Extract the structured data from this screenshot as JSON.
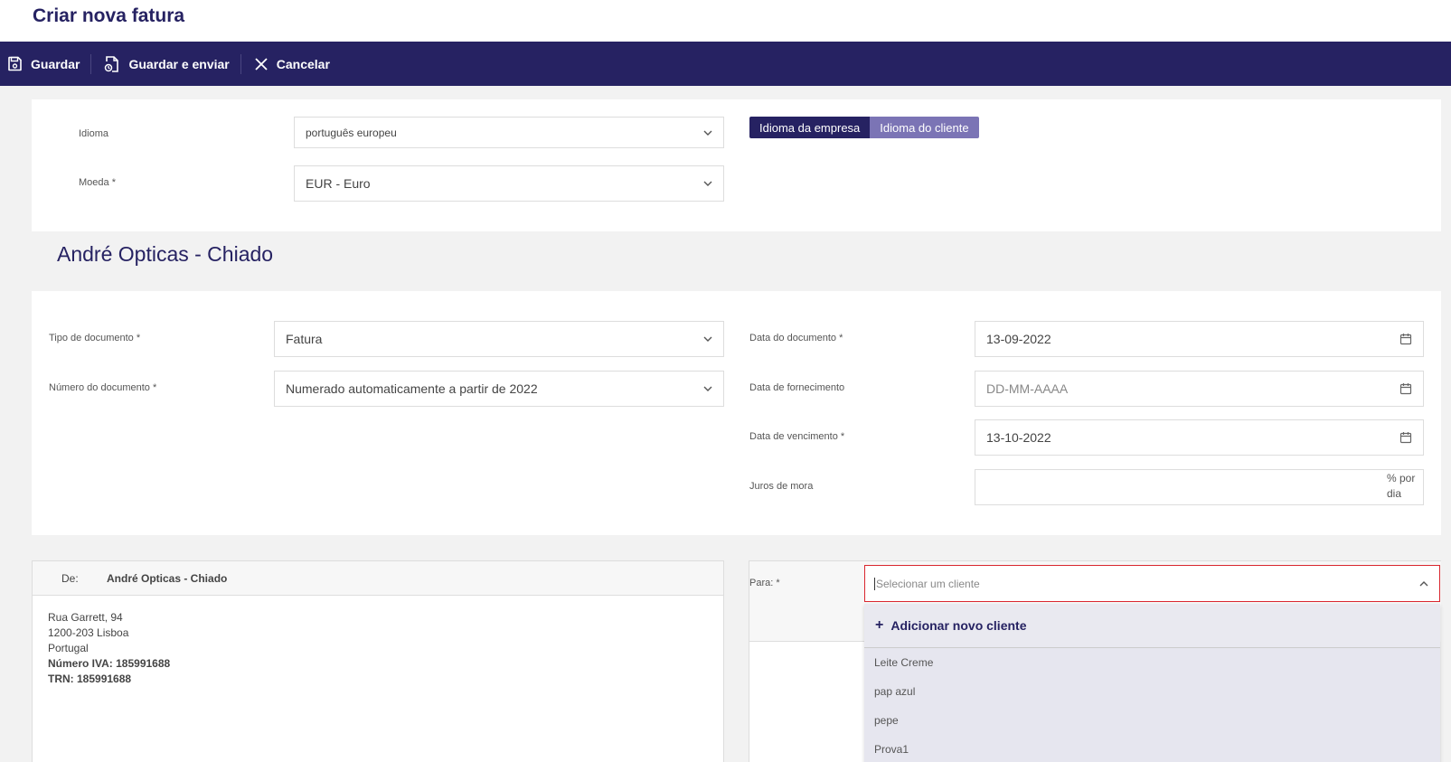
{
  "page": {
    "title": "Criar nova fatura"
  },
  "toolbar": {
    "save_label": "Guardar",
    "save_send_label": "Guardar e enviar",
    "cancel_label": "Cancelar"
  },
  "settings": {
    "language_label": "Idioma",
    "language_value": "português europeu",
    "currency_label": "Moeda *",
    "currency_value": "EUR - Euro",
    "company_lang_btn": "Idioma da empresa",
    "client_lang_btn": "Idioma do cliente"
  },
  "company": {
    "name": "André Opticas - Chiado"
  },
  "document": {
    "type_label": "Tipo de documento *",
    "type_value": "Fatura",
    "number_label": "Número do documento *",
    "number_value": "Numerado automaticamente a partir de 2022",
    "date_label": "Data do documento *",
    "date_value": "13-09-2022",
    "supply_label": "Data de fornecimento",
    "supply_placeholder": "DD-MM-AAAA",
    "due_label": "Data de vencimento *",
    "due_value": "13-10-2022",
    "interest_label": "Juros de mora",
    "interest_suffix_1": "% por",
    "interest_suffix_2": "dia"
  },
  "from": {
    "label": "De:",
    "name": "André Opticas - Chiado",
    "address_line1": "Rua Garrett, 94",
    "address_line2": "1200-203 Lisboa",
    "address_line3": "Portugal",
    "vat": "Número IVA: 185991688",
    "trn": "TRN: 185991688"
  },
  "to": {
    "label": "Para: *",
    "placeholder": "Selecionar um cliente",
    "add_new": "Adicionar novo cliente",
    "clients": [
      "Leite Creme",
      "pap azul",
      "pepe",
      "Prova1"
    ]
  },
  "colors": {
    "brand": "#262262",
    "accent_light": "#7b74b5",
    "error": "#d9262e"
  }
}
